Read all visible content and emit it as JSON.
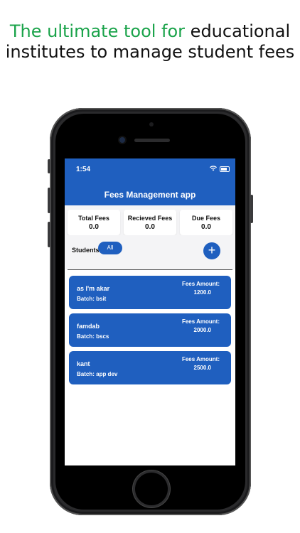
{
  "headline": {
    "accent": "The ultimate tool for",
    "rest": " educational institutes to manage student fees"
  },
  "status": {
    "time": "1:54"
  },
  "app": {
    "title": "Fees Management app"
  },
  "stats": [
    {
      "label": "Total Fees",
      "value": "0.0"
    },
    {
      "label": "Recieved Fees",
      "value": "0.0"
    },
    {
      "label": "Due Fees",
      "value": "0.0"
    }
  ],
  "students": {
    "label": "Students",
    "filter_chip": "All",
    "add_label": "+"
  },
  "cards": [
    {
      "name": "as I'm akar",
      "batch": "Batch: bsit",
      "fees_label": "Fees Amount:",
      "fees_value": "1200.0"
    },
    {
      "name": "famdab",
      "batch": "Batch: bscs",
      "fees_label": "Fees Amount:",
      "fees_value": "2000.0"
    },
    {
      "name": "kant",
      "batch": "Batch: app dev",
      "fees_label": "Fees Amount:",
      "fees_value": "2500.0"
    }
  ],
  "colors": {
    "primary": "#1f5fbf",
    "accent_green": "#1aa34a"
  }
}
